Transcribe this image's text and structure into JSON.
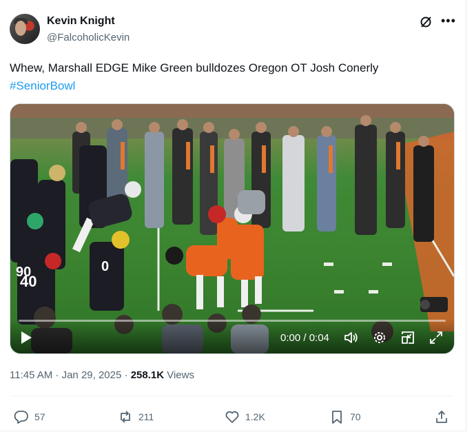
{
  "author": {
    "name": "Kevin Knight",
    "handle": "@FalcoholicKevin"
  },
  "tweet": {
    "text": "Whew, Marshall EDGE Mike Green bulldozes Oregon OT Josh Conerly",
    "hashtag": "#SeniorBowl"
  },
  "video": {
    "time": "0:00 / 0:04",
    "jersey_numbers": [
      "90",
      "40",
      "0"
    ]
  },
  "meta": {
    "timestamp": "11:45 AM · Jan 29, 2025",
    "separator": " · ",
    "views_count": "258.1K",
    "views_label": "Views"
  },
  "actions": {
    "replies": "57",
    "reposts": "211",
    "likes": "1.2K",
    "bookmarks": "70"
  },
  "icons": {
    "grok": "grok-icon",
    "more": "more-icon",
    "play": "play-icon",
    "volume": "volume-icon",
    "settings": "settings-icon",
    "pip": "picture-in-picture-icon",
    "fullscreen": "fullscreen-icon",
    "reply": "reply-icon",
    "repost": "repost-icon",
    "like": "like-icon",
    "bookmark": "bookmark-icon",
    "share": "share-icon"
  },
  "colors": {
    "accent": "#1d9bf0",
    "secondary_text": "#536471",
    "primary_text": "#0f1419"
  }
}
